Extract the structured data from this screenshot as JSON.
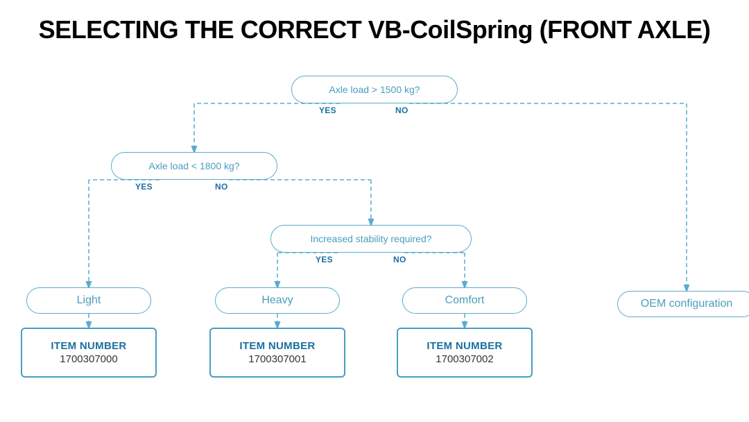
{
  "page": {
    "title": "SELECTING THE CORRECT VB-CoilSpring (FRONT AXLE)"
  },
  "decisions": {
    "d1": {
      "label": "Axle load > 1500 kg?",
      "yes": "YES",
      "no": "NO"
    },
    "d2": {
      "label": "Axle load < 1800 kg?",
      "yes": "YES",
      "no": "NO"
    },
    "d3": {
      "label": "Increased stability required?",
      "yes": "YES",
      "no": "NO"
    }
  },
  "results": {
    "light": "Light",
    "heavy": "Heavy",
    "comfort": "Comfort",
    "oem": "OEM configuration"
  },
  "items": {
    "item0": {
      "label": "ITEM NUMBER",
      "number": "1700307000"
    },
    "item1": {
      "label": "ITEM NUMBER",
      "number": "1700307001"
    },
    "item2": {
      "label": "ITEM NUMBER",
      "number": "1700307002"
    }
  },
  "colors": {
    "accent": "#4a9dbf",
    "border": "#5aabcf",
    "text_dark": "#1a6fa0"
  }
}
